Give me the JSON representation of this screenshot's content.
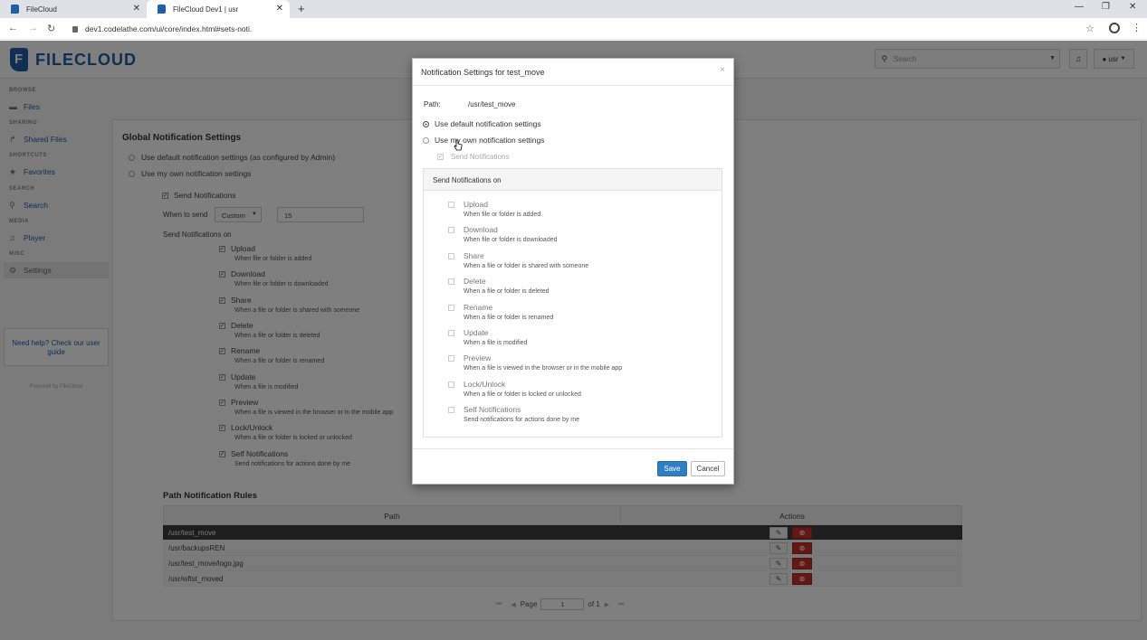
{
  "browser": {
    "tabs": [
      {
        "label": "FileCloud"
      },
      {
        "label": "FileCloud Dev1 | usr"
      }
    ],
    "url": "dev1.codelathe.com/ui/core/index.html#sets-noti."
  },
  "header": {
    "logo": "FILECLOUD",
    "search_placeholder": "Search",
    "user_label": "usr"
  },
  "sidebar": {
    "sections": [
      {
        "title": "BROWSE",
        "item": "Files",
        "icon": "folder-icon"
      },
      {
        "title": "SHARING",
        "item": "Shared Files",
        "icon": "share-icon"
      },
      {
        "title": "SHORTCUTS",
        "item": "Favorites",
        "icon": "star-icon"
      },
      {
        "title": "SEARCH",
        "item": "Search",
        "icon": "search-icon"
      },
      {
        "title": "MEDIA",
        "item": "Player",
        "icon": "music-icon"
      },
      {
        "title": "MISC",
        "item": "Settings",
        "icon": "gear-icon"
      }
    ],
    "help_text": "Need help? Check our user guide",
    "powered_by": "Powered by FileCloud"
  },
  "global": {
    "title": "Global Notification Settings",
    "radio_default": "Use default notification settings (as configured by Admin)",
    "radio_own": "Use my own notification settings",
    "send_notifications": "Send Notifications",
    "when_to_send_label": "When to send",
    "when_to_send_value": "Custom",
    "minutes_value": "15",
    "send_on_label": "Send Notifications on",
    "items": [
      {
        "label": "Upload",
        "desc": "When file or folder is added"
      },
      {
        "label": "Download",
        "desc": "When file or folder is downloaded"
      },
      {
        "label": "Share",
        "desc": "When a file or folder is shared with someone"
      },
      {
        "label": "Delete",
        "desc": "When a file or folder is deleted"
      },
      {
        "label": "Rename",
        "desc": "When a file or folder is renamed"
      },
      {
        "label": "Update",
        "desc": "When a file is modified"
      },
      {
        "label": "Preview",
        "desc": "When a file is viewed in the browser or in the mobile app"
      },
      {
        "label": "Lock/Unlock",
        "desc": "When a file or folder is locked or unlocked"
      },
      {
        "label": "Self Notifications",
        "desc": "Send notifications for actions done by me"
      }
    ]
  },
  "path_rules": {
    "title": "Path Notification Rules",
    "columns": [
      "Path",
      "Actions"
    ],
    "rows": [
      "/usr/test_move",
      "/usr/backupsREN",
      "/usr/test_move/logo.jpg",
      "/usr/wftst_moved"
    ],
    "pager": {
      "page_label": "Page",
      "page_value": "1",
      "of_label": "of 1"
    }
  },
  "modal": {
    "title": "Notification Settings for test_move",
    "path_label": "Path:",
    "path_value": "/usr/test_move",
    "radio_default": "Use default notification settings",
    "radio_own": "Use my own notification settings",
    "send_notifications": "Send Notifications",
    "panel_title": "Send Notifications on",
    "items": [
      {
        "label": "Upload",
        "desc": "When file or folder is added"
      },
      {
        "label": "Download",
        "desc": "When file or folder is downloaded"
      },
      {
        "label": "Share",
        "desc": "When a file or folder is shared with someone"
      },
      {
        "label": "Delete",
        "desc": "When a file or folder is deleted"
      },
      {
        "label": "Rename",
        "desc": "When a file or folder is renamed"
      },
      {
        "label": "Update",
        "desc": "When a file is modified"
      },
      {
        "label": "Preview",
        "desc": "When a file is viewed in the browser or in the mobile app"
      },
      {
        "label": "Lock/Unlock",
        "desc": "When a file or folder is locked or unlocked"
      },
      {
        "label": "Self Notifications",
        "desc": "Send notifications for actions done by me"
      }
    ],
    "save_label": "Save",
    "cancel_label": "Cancel"
  },
  "colors": {
    "brand": "#1f5fa8",
    "primary_button": "#2f7ec4",
    "danger_button": "#c9302c",
    "selected_row": "#3c3c3c"
  }
}
